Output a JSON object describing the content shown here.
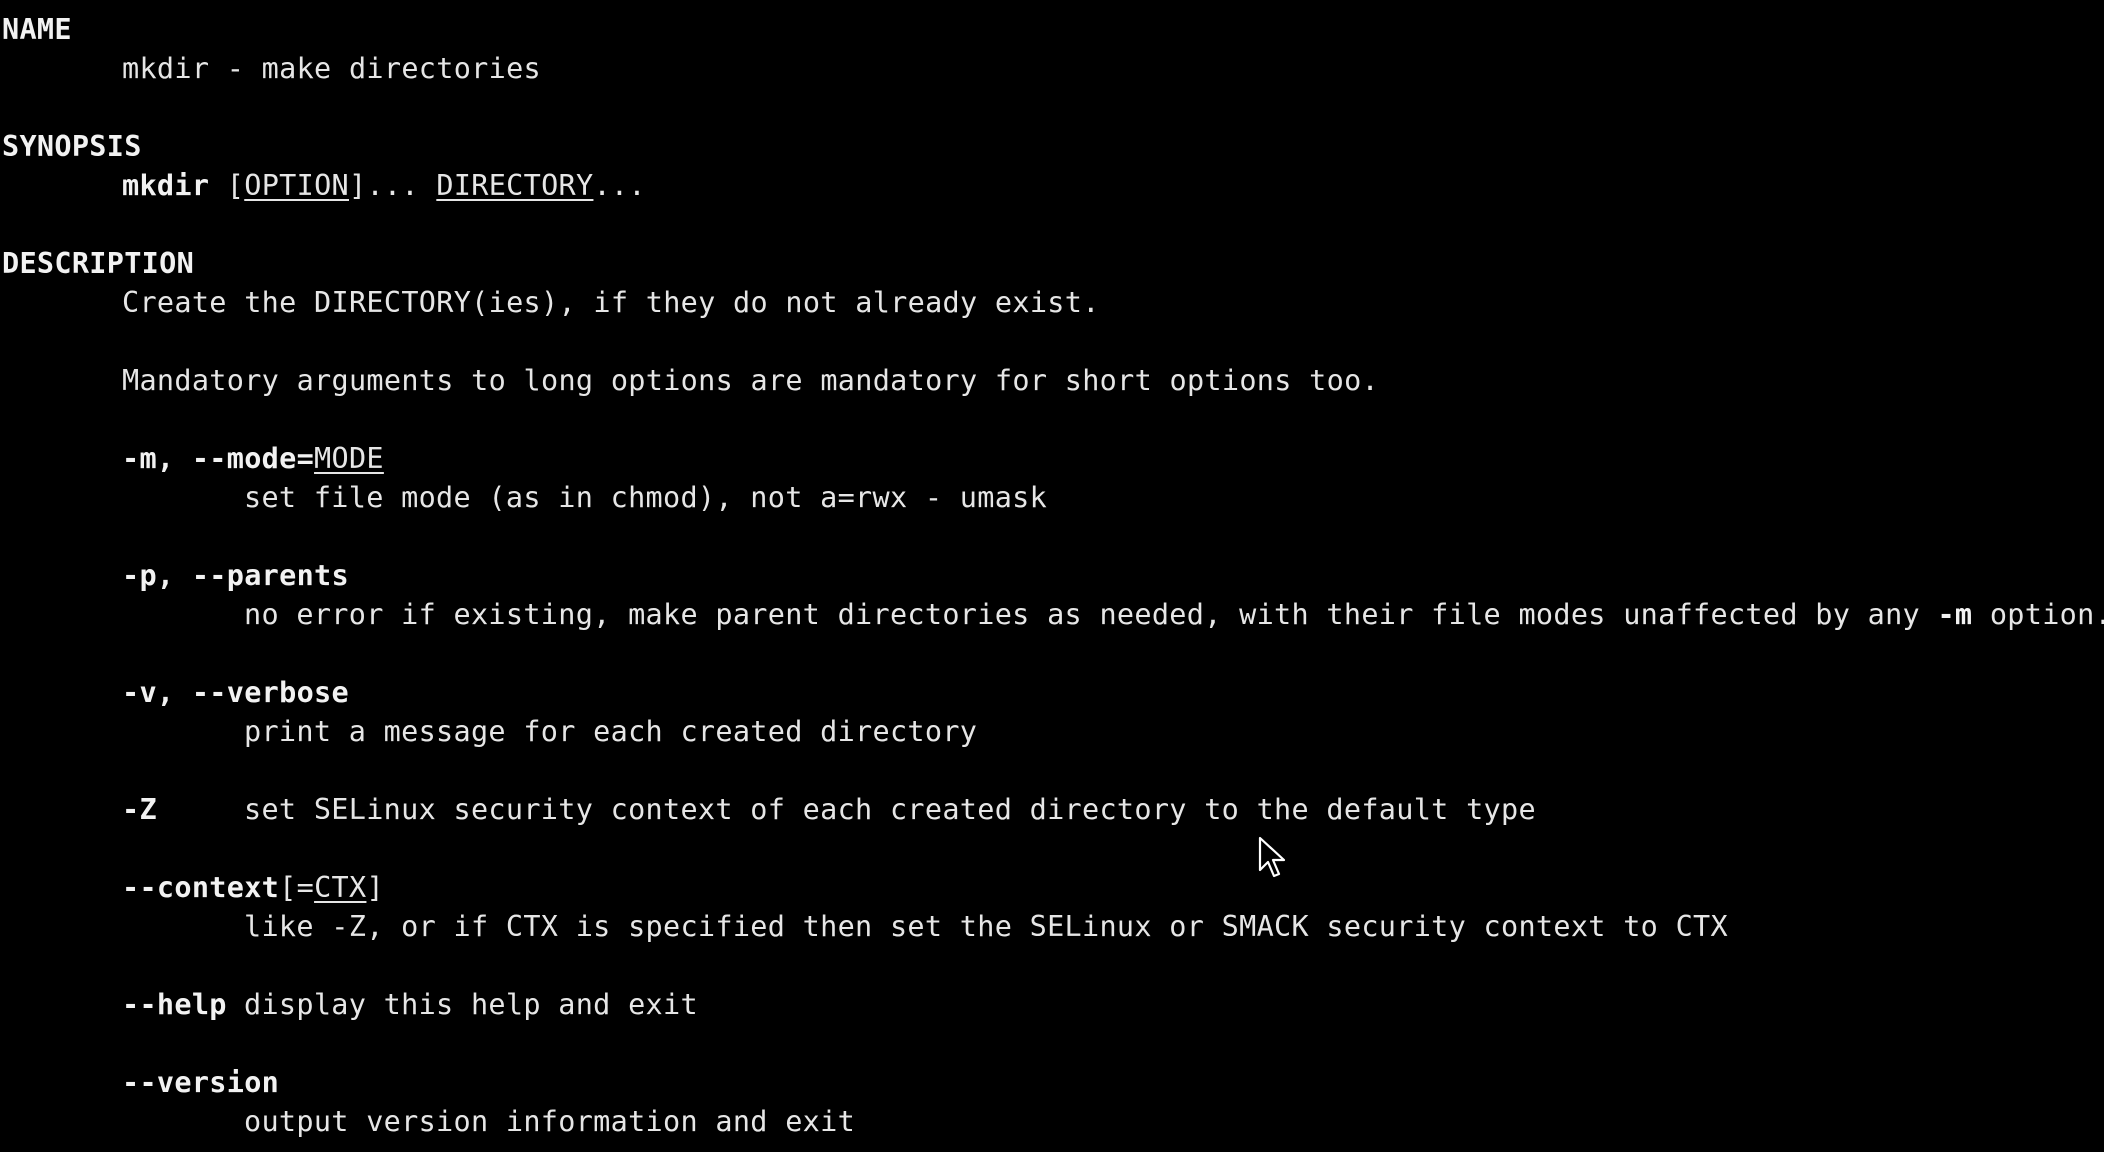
{
  "sections": {
    "name": {
      "header": "NAME",
      "text": "mkdir - make directories"
    },
    "synopsis": {
      "header": "SYNOPSIS",
      "cmd": "mkdir",
      "lbracket": "[",
      "option": "OPTION",
      "rbracket_dots": "]...",
      "directory": "DIRECTORY",
      "dots": "..."
    },
    "description": {
      "header": "DESCRIPTION",
      "line1": "Create the DIRECTORY(ies), if they do not already exist.",
      "line2": "Mandatory arguments to long options are mandatory for short options too."
    }
  },
  "options": {
    "mode": {
      "flag": "-m, --mode=",
      "arg": "MODE",
      "desc": "set file mode (as in chmod), not a=rwx - umask"
    },
    "parents": {
      "flag": "-p, --parents",
      "desc": "no error if existing, make parent directories as needed, with their file modes unaffected by any ",
      "desc_flag": "-m",
      "desc_end": " option."
    },
    "verbose": {
      "flag": "-v, --verbose",
      "desc": "print a message for each created directory"
    },
    "z": {
      "flag": "-Z",
      "desc": "set SELinux security context of each created directory to the default type"
    },
    "context": {
      "flag": "--context",
      "lbracket": "[=",
      "arg": "CTX",
      "rbracket": "]",
      "desc": "like -Z, or if CTX is specified then set the SELinux or SMACK security context to CTX"
    },
    "help": {
      "flag": "--help",
      "desc": "display this help and exit"
    },
    "version": {
      "flag": "--version",
      "desc": "output version information and exit"
    }
  },
  "icons": {
    "cursor": "mouse-pointer-icon"
  }
}
